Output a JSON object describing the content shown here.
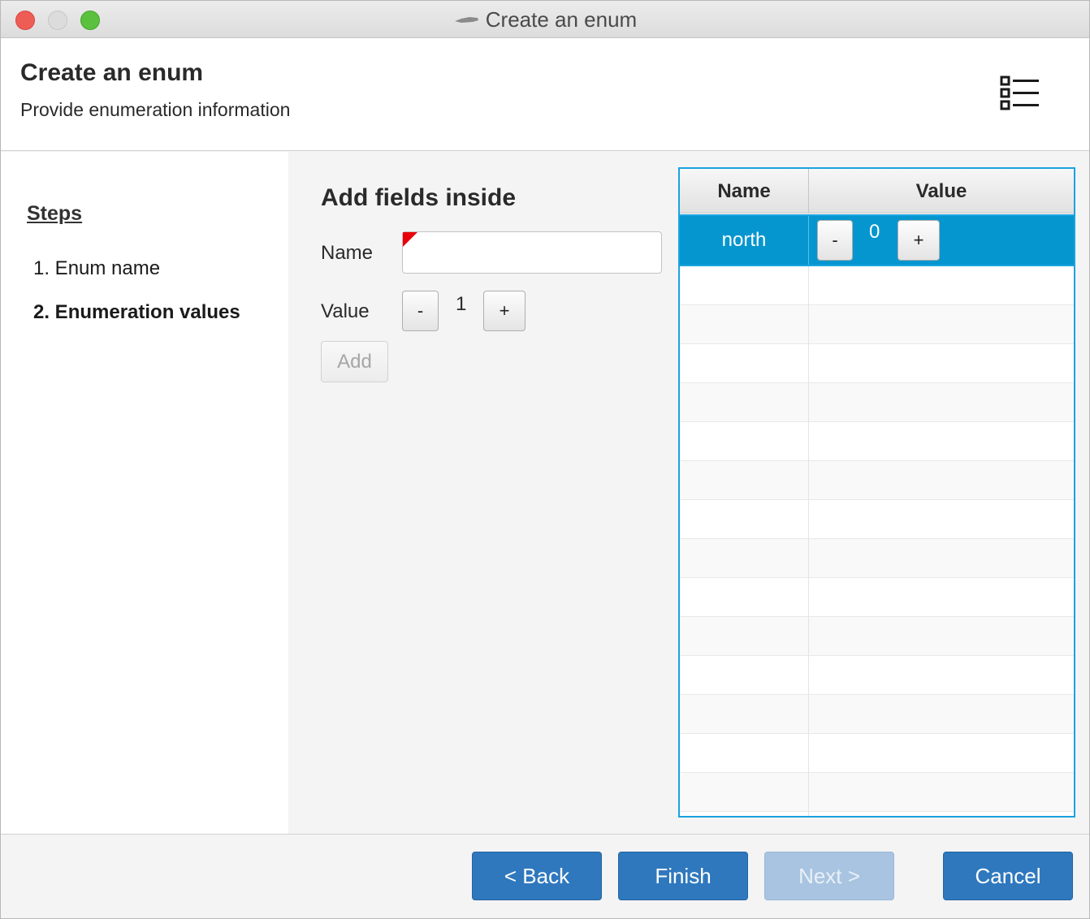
{
  "window": {
    "title": "Create an enum"
  },
  "header": {
    "title": "Create an enum",
    "subtitle": "Provide enumeration information",
    "icon": "list-icon"
  },
  "steps": {
    "heading": "Steps",
    "items": [
      {
        "label": "1. Enum name",
        "active": false
      },
      {
        "label": "2. Enumeration values",
        "active": true
      }
    ]
  },
  "form": {
    "title": "Add fields inside",
    "name_label": "Name",
    "name_value": "",
    "value_label": "Value",
    "decrement_label": "-",
    "increment_label": "+",
    "value": "1",
    "add_label": "Add"
  },
  "table": {
    "columns": [
      "Name",
      "Value"
    ],
    "rows": [
      {
        "name": "north",
        "value": "0",
        "decrement_label": "-",
        "increment_label": "+",
        "selected": true
      }
    ]
  },
  "footer": {
    "back_label": "< Back",
    "finish_label": "Finish",
    "next_label": "Next >",
    "cancel_label": "Cancel"
  },
  "colors": {
    "accent": "#2f78be",
    "selection": "#0596cf",
    "table_border": "#1aa3e0",
    "required_marker": "#e8000b"
  }
}
